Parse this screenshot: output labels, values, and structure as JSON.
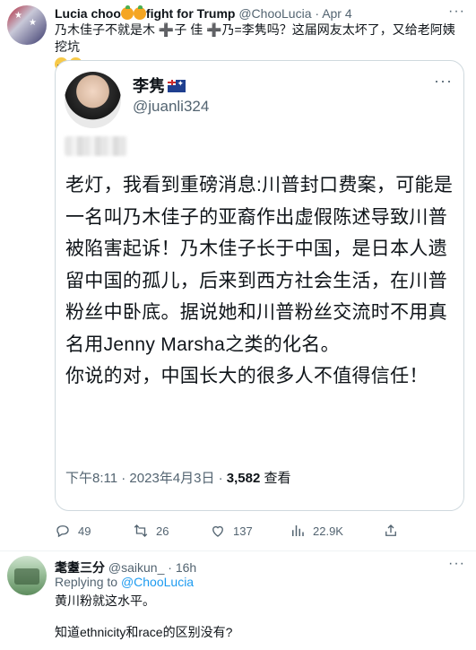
{
  "tweet": {
    "name_prefix": "Lucia choo",
    "name_suffix": "fight for Trump",
    "handle": "@ChooLucia",
    "separator": "·",
    "date": "Apr 4",
    "text_line1": "乃木佳子不就是木 ➕子 佳 ➕乃=李隽吗？这届网友太坏了，又给老阿姨挖坑",
    "more_icon": "more-horizontal-icon"
  },
  "media": {
    "name": "李隽",
    "flag": "australia-flag",
    "handle": "@juanli324",
    "paragraphs": [
      "老灯，我看到重磅消息:川普封口费案，可能是一名叫乃木佳子的亚裔作出虚假陈述导致川普被陷害起诉！乃木佳子长于中国，是日本人遗留中国的孤儿，后来到西方社会生活，在川普粉丝中卧底。据说她和川普粉丝交流时不用真名用Jenny Marsha之类的化名。",
      "你说的对，中国长大的很多人不值得信任！"
    ],
    "timestamp": "下午8:11 · 2023年4月3日 · ",
    "views_count": "3,582",
    "views_label": " 查看"
  },
  "actions": {
    "replies": "49",
    "retweets": "26",
    "likes": "137",
    "views": "22.9K"
  },
  "reply": {
    "name": "耄耋三分",
    "handle": "@saikun_",
    "separator": "·",
    "date": "16h",
    "replying_label": "Replying to ",
    "replying_to": "@ChooLucia",
    "text1": "黄川粉就这水平。",
    "text2": "知道ethnicity和race的区别没有?"
  },
  "colors": {
    "text": "#0f1419",
    "secondary": "#536471",
    "link": "#1d9bf0",
    "border": "#cfd9de"
  }
}
